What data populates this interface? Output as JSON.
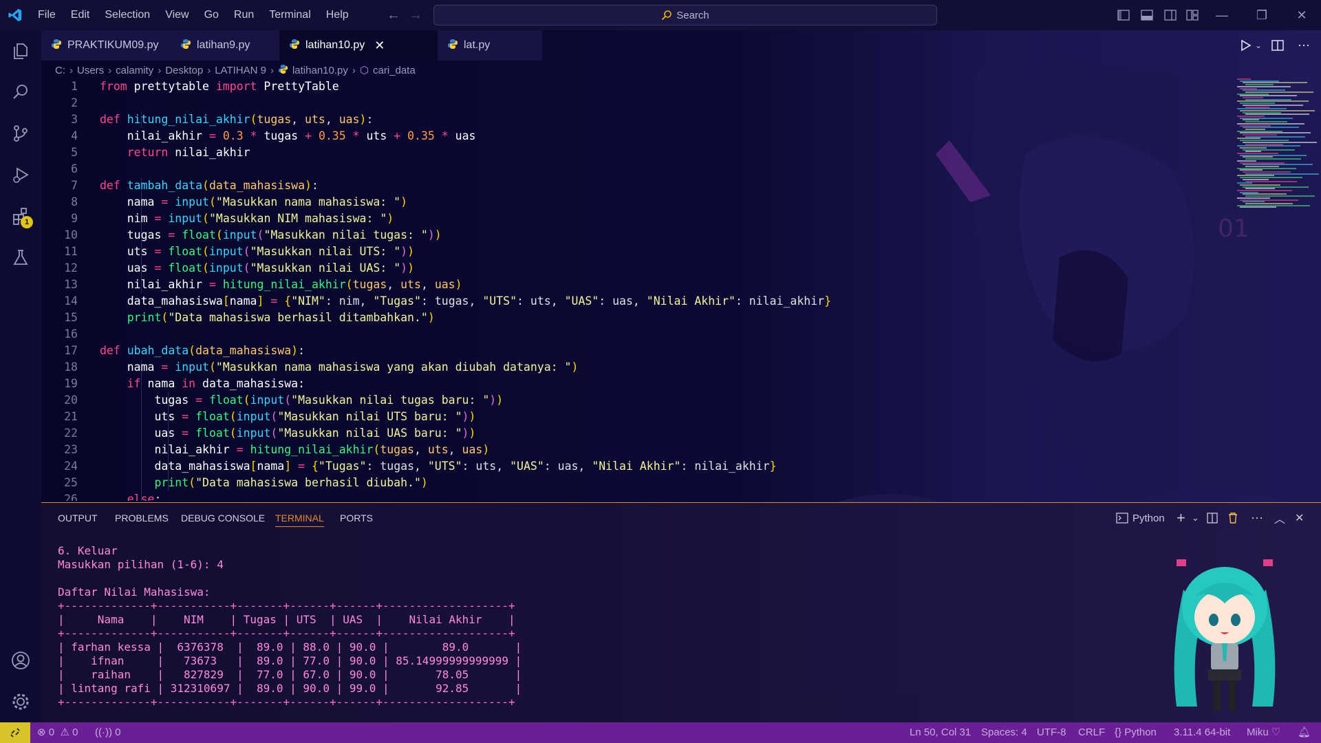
{
  "app": {
    "menu": [
      "File",
      "Edit",
      "Selection",
      "View",
      "Go",
      "Run",
      "Terminal",
      "Help"
    ],
    "search_placeholder": "Search"
  },
  "tabs": [
    {
      "label": "PRAKTIKUM09.py",
      "active": false
    },
    {
      "label": "latihan9.py",
      "active": false
    },
    {
      "label": "latihan10.py",
      "active": true
    },
    {
      "label": "lat.py",
      "active": false
    }
  ],
  "breadcrumb": [
    "C:",
    "Users",
    "calamity",
    "Desktop",
    "LATIHAN 9",
    "latihan10.py",
    "cari_data"
  ],
  "activity": {
    "extensions_badge": "1"
  },
  "editor": {
    "lines": [
      {
        "n": "1",
        "tokens": [
          [
            "kw",
            "from"
          ],
          [
            "var",
            " prettytable "
          ],
          [
            "kw",
            "import"
          ],
          [
            "var",
            " PrettyTable"
          ]
        ]
      },
      {
        "n": "2",
        "tokens": []
      },
      {
        "n": "3",
        "tokens": [
          [
            "kw",
            "def"
          ],
          [
            "var",
            " "
          ],
          [
            "fn",
            "hitung_nilai_akhir"
          ],
          [
            "br",
            "("
          ],
          [
            "prm",
            "tugas"
          ],
          [
            "pun",
            ", "
          ],
          [
            "prm",
            "uts"
          ],
          [
            "pun",
            ", "
          ],
          [
            "prm",
            "uas"
          ],
          [
            "br",
            ")"
          ],
          [
            "pun",
            ":"
          ]
        ]
      },
      {
        "n": "4",
        "tokens": [
          [
            "var",
            "    nilai_akhir "
          ],
          [
            "op",
            "="
          ],
          [
            "var",
            " "
          ],
          [
            "num",
            "0.3"
          ],
          [
            "var",
            " "
          ],
          [
            "op",
            "*"
          ],
          [
            "var",
            " tugas "
          ],
          [
            "op",
            "+"
          ],
          [
            "var",
            " "
          ],
          [
            "num",
            "0.35"
          ],
          [
            "var",
            " "
          ],
          [
            "op",
            "*"
          ],
          [
            "var",
            " uts "
          ],
          [
            "op",
            "+"
          ],
          [
            "var",
            " "
          ],
          [
            "num",
            "0.35"
          ],
          [
            "var",
            " "
          ],
          [
            "op",
            "*"
          ],
          [
            "var",
            " uas"
          ]
        ]
      },
      {
        "n": "5",
        "tokens": [
          [
            "var",
            "    "
          ],
          [
            "kw",
            "return"
          ],
          [
            "var",
            " nilai_akhir"
          ]
        ]
      },
      {
        "n": "6",
        "tokens": []
      },
      {
        "n": "7",
        "tokens": [
          [
            "kw",
            "def"
          ],
          [
            "var",
            " "
          ],
          [
            "fn",
            "tambah_data"
          ],
          [
            "br",
            "("
          ],
          [
            "prm",
            "data_mahasiswa"
          ],
          [
            "br",
            ")"
          ],
          [
            "pun",
            ":"
          ]
        ]
      },
      {
        "n": "8",
        "tokens": [
          [
            "var",
            "    nama "
          ],
          [
            "op",
            "="
          ],
          [
            "var",
            " "
          ],
          [
            "fn",
            "input"
          ],
          [
            "br",
            "("
          ],
          [
            "str",
            "\"Masukkan nama mahasiswa: \""
          ],
          [
            "br",
            ")"
          ]
        ]
      },
      {
        "n": "9",
        "tokens": [
          [
            "var",
            "    nim "
          ],
          [
            "op",
            "="
          ],
          [
            "var",
            " "
          ],
          [
            "fn",
            "input"
          ],
          [
            "br",
            "("
          ],
          [
            "str",
            "\"Masukkan NIM mahasiswa: \""
          ],
          [
            "br",
            ")"
          ]
        ]
      },
      {
        "n": "10",
        "tokens": [
          [
            "var",
            "    tugas "
          ],
          [
            "op",
            "="
          ],
          [
            "var",
            " "
          ],
          [
            "bi",
            "float"
          ],
          [
            "br",
            "("
          ],
          [
            "fn",
            "input"
          ],
          [
            "br2",
            "("
          ],
          [
            "str",
            "\"Masukkan nilai tugas: \""
          ],
          [
            "br2",
            ")"
          ],
          [
            "br",
            ")"
          ]
        ]
      },
      {
        "n": "11",
        "tokens": [
          [
            "var",
            "    uts "
          ],
          [
            "op",
            "="
          ],
          [
            "var",
            " "
          ],
          [
            "bi",
            "float"
          ],
          [
            "br",
            "("
          ],
          [
            "fn",
            "input"
          ],
          [
            "br2",
            "("
          ],
          [
            "str",
            "\"Masukkan nilai UTS: \""
          ],
          [
            "br2",
            ")"
          ],
          [
            "br",
            ")"
          ]
        ]
      },
      {
        "n": "12",
        "tokens": [
          [
            "var",
            "    uas "
          ],
          [
            "op",
            "="
          ],
          [
            "var",
            " "
          ],
          [
            "bi",
            "float"
          ],
          [
            "br",
            "("
          ],
          [
            "fn",
            "input"
          ],
          [
            "br2",
            "("
          ],
          [
            "str",
            "\"Masukkan nilai UAS: \""
          ],
          [
            "br2",
            ")"
          ],
          [
            "br",
            ")"
          ]
        ]
      },
      {
        "n": "13",
        "tokens": [
          [
            "var",
            "    nilai_akhir "
          ],
          [
            "op",
            "="
          ],
          [
            "var",
            " "
          ],
          [
            "bi",
            "hitung_nilai_akhir"
          ],
          [
            "br",
            "("
          ],
          [
            "prm",
            "tugas"
          ],
          [
            "pun",
            ", "
          ],
          [
            "prm",
            "uts"
          ],
          [
            "pun",
            ", "
          ],
          [
            "prm",
            "uas"
          ],
          [
            "br",
            ")"
          ]
        ]
      },
      {
        "n": "14",
        "tokens": [
          [
            "var",
            "    data_mahasiswa"
          ],
          [
            "br",
            "["
          ],
          [
            "var",
            "nama"
          ],
          [
            "br",
            "]"
          ],
          [
            "var",
            " "
          ],
          [
            "op",
            "="
          ],
          [
            "var",
            " "
          ],
          [
            "br",
            "{"
          ],
          [
            "str",
            "\"NIM\""
          ],
          [
            "pun",
            ": nim, "
          ],
          [
            "str",
            "\"Tugas\""
          ],
          [
            "pun",
            ": tugas, "
          ],
          [
            "str",
            "\"UTS\""
          ],
          [
            "pun",
            ": uts, "
          ],
          [
            "str",
            "\"UAS\""
          ],
          [
            "pun",
            ": uas, "
          ],
          [
            "str",
            "\"Nilai Akhir\""
          ],
          [
            "pun",
            ": nilai_akhir"
          ],
          [
            "br",
            "}"
          ]
        ]
      },
      {
        "n": "15",
        "tokens": [
          [
            "var",
            "    "
          ],
          [
            "bi",
            "print"
          ],
          [
            "br",
            "("
          ],
          [
            "str",
            "\"Data mahasiswa berhasil ditambahkan.\""
          ],
          [
            "br",
            ")"
          ]
        ]
      },
      {
        "n": "16",
        "tokens": []
      },
      {
        "n": "17",
        "tokens": [
          [
            "kw",
            "def"
          ],
          [
            "var",
            " "
          ],
          [
            "fn",
            "ubah_data"
          ],
          [
            "br",
            "("
          ],
          [
            "prm",
            "data_mahasiswa"
          ],
          [
            "br",
            ")"
          ],
          [
            "pun",
            ":"
          ]
        ]
      },
      {
        "n": "18",
        "tokens": [
          [
            "var",
            "    nama "
          ],
          [
            "op",
            "="
          ],
          [
            "var",
            " "
          ],
          [
            "fn",
            "input"
          ],
          [
            "br",
            "("
          ],
          [
            "str",
            "\"Masukkan nama mahasiswa yang akan diubah datanya: \""
          ],
          [
            "br",
            ")"
          ]
        ]
      },
      {
        "n": "19",
        "tokens": [
          [
            "var",
            "    "
          ],
          [
            "kw",
            "if"
          ],
          [
            "var",
            " nama "
          ],
          [
            "kw",
            "in"
          ],
          [
            "var",
            " data_mahasiswa:"
          ]
        ]
      },
      {
        "n": "20",
        "tokens": [
          [
            "var",
            "        tugas "
          ],
          [
            "op",
            "="
          ],
          [
            "var",
            " "
          ],
          [
            "bi",
            "float"
          ],
          [
            "br",
            "("
          ],
          [
            "fn",
            "input"
          ],
          [
            "br2",
            "("
          ],
          [
            "str",
            "\"Masukkan nilai tugas baru: \""
          ],
          [
            "br2",
            ")"
          ],
          [
            "br",
            ")"
          ]
        ]
      },
      {
        "n": "21",
        "tokens": [
          [
            "var",
            "        uts "
          ],
          [
            "op",
            "="
          ],
          [
            "var",
            " "
          ],
          [
            "bi",
            "float"
          ],
          [
            "br",
            "("
          ],
          [
            "fn",
            "input"
          ],
          [
            "br2",
            "("
          ],
          [
            "str",
            "\"Masukkan nilai UTS baru: \""
          ],
          [
            "br2",
            ")"
          ],
          [
            "br",
            ")"
          ]
        ]
      },
      {
        "n": "22",
        "tokens": [
          [
            "var",
            "        uas "
          ],
          [
            "op",
            "="
          ],
          [
            "var",
            " "
          ],
          [
            "bi",
            "float"
          ],
          [
            "br",
            "("
          ],
          [
            "fn",
            "input"
          ],
          [
            "br2",
            "("
          ],
          [
            "str",
            "\"Masukkan nilai UAS baru: \""
          ],
          [
            "br2",
            ")"
          ],
          [
            "br",
            ")"
          ]
        ]
      },
      {
        "n": "23",
        "tokens": [
          [
            "var",
            "        nilai_akhir "
          ],
          [
            "op",
            "="
          ],
          [
            "var",
            " "
          ],
          [
            "bi",
            "hitung_nilai_akhir"
          ],
          [
            "br",
            "("
          ],
          [
            "prm",
            "tugas"
          ],
          [
            "pun",
            ", "
          ],
          [
            "prm",
            "uts"
          ],
          [
            "pun",
            ", "
          ],
          [
            "prm",
            "uas"
          ],
          [
            "br",
            ")"
          ]
        ]
      },
      {
        "n": "24",
        "tokens": [
          [
            "var",
            "        data_mahasiswa"
          ],
          [
            "br",
            "["
          ],
          [
            "var",
            "nama"
          ],
          [
            "br",
            "]"
          ],
          [
            "var",
            " "
          ],
          [
            "op",
            "="
          ],
          [
            "var",
            " "
          ],
          [
            "br",
            "{"
          ],
          [
            "str",
            "\"Tugas\""
          ],
          [
            "pun",
            ": tugas, "
          ],
          [
            "str",
            "\"UTS\""
          ],
          [
            "pun",
            ": uts, "
          ],
          [
            "str",
            "\"UAS\""
          ],
          [
            "pun",
            ": uas, "
          ],
          [
            "str",
            "\"Nilai Akhir\""
          ],
          [
            "pun",
            ": nilai_akhir"
          ],
          [
            "br",
            "}"
          ]
        ]
      },
      {
        "n": "25",
        "tokens": [
          [
            "var",
            "        "
          ],
          [
            "bi",
            "print"
          ],
          [
            "br",
            "("
          ],
          [
            "str",
            "\"Data mahasiswa berhasil diubah.\""
          ],
          [
            "br",
            ")"
          ]
        ]
      },
      {
        "n": "26",
        "tokens": [
          [
            "var",
            "    "
          ],
          [
            "kw",
            "else"
          ],
          [
            "pun",
            ":"
          ]
        ]
      }
    ]
  },
  "panel": {
    "tabs": [
      "OUTPUT",
      "PROBLEMS",
      "DEBUG CONSOLE",
      "TERMINAL",
      "PORTS"
    ],
    "active_tab": "TERMINAL",
    "terminal_profile": "Python",
    "terminal_lines": [
      "6. Keluar",
      "Masukkan pilihan (1-6): 4",
      "",
      "Daftar Nilai Mahasiswa:",
      "+-------------+-----------+-------+------+------+-------------------+",
      "|     Nama    |    NIM    | Tugas | UTS  | UAS  |    Nilai Akhir    |",
      "+-------------+-----------+-------+------+------+-------------------+",
      "| farhan kessa |  6376378  |  89.0 | 88.0 | 90.0 |        89.0       |",
      "|    ifnan     |   73673   |  89.0 | 77.0 | 90.0 | 85.14999999999999 |",
      "|    raihan    |   827829  |  77.0 | 67.0 | 90.0 |       78.05       |",
      "| lintang rafi | 312310697 |  89.0 | 90.0 | 99.0 |       92.85       |",
      "+-------------+-----------+-------+------+------+-------------------+"
    ]
  },
  "status": {
    "errors": "0",
    "warnings": "0",
    "ports": "0",
    "position": "Ln 50, Col 31",
    "spaces": "Spaces: 4",
    "encoding": "UTF-8",
    "eol": "CRLF",
    "language": "Python",
    "interpreter": "3.11.4 64-bit",
    "theme": "Miku"
  },
  "colors": {
    "accent": "#e08a2a",
    "statusbar": "#6a1f94",
    "keyword": "#ff4a8d",
    "function": "#3fd3ff",
    "string": "#f3f39a"
  }
}
